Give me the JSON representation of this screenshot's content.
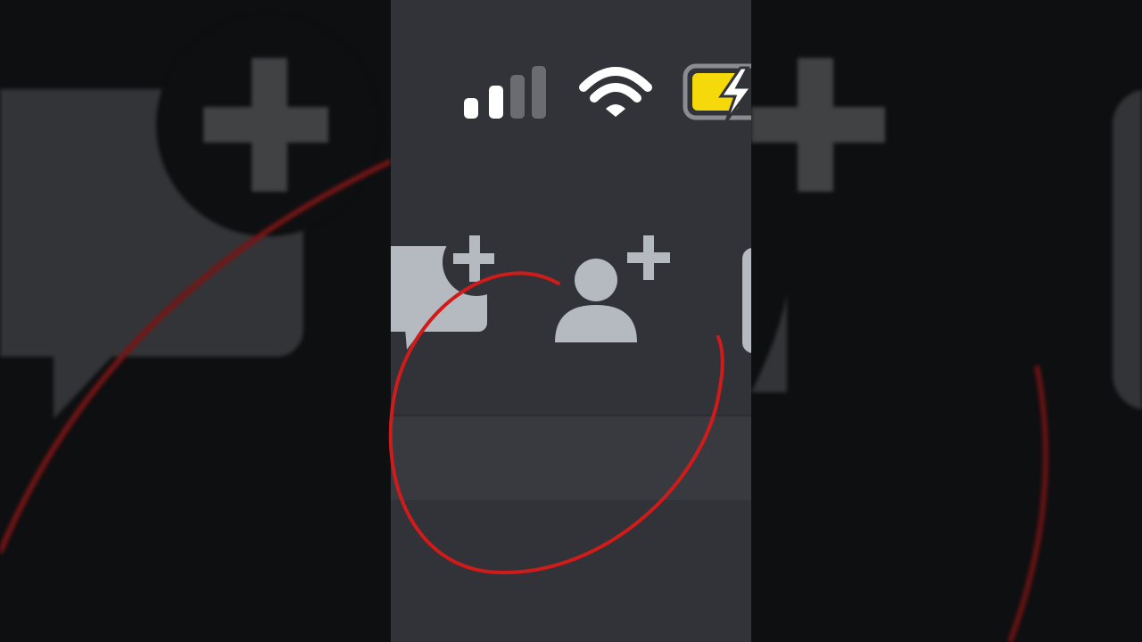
{
  "status_bar": {
    "signal_icon": "cellular-signal-icon",
    "wifi_icon": "wifi-icon",
    "battery_icon": "battery-charging-icon",
    "battery_color": "#f5d90a"
  },
  "header": {
    "new_dm_icon": "new-message-plus-icon",
    "add_friend_icon": "add-friend-icon"
  },
  "colors": {
    "screen_bg": "#313338",
    "icon_color": "#b5bac1",
    "annotation_color": "#d01b1b"
  }
}
